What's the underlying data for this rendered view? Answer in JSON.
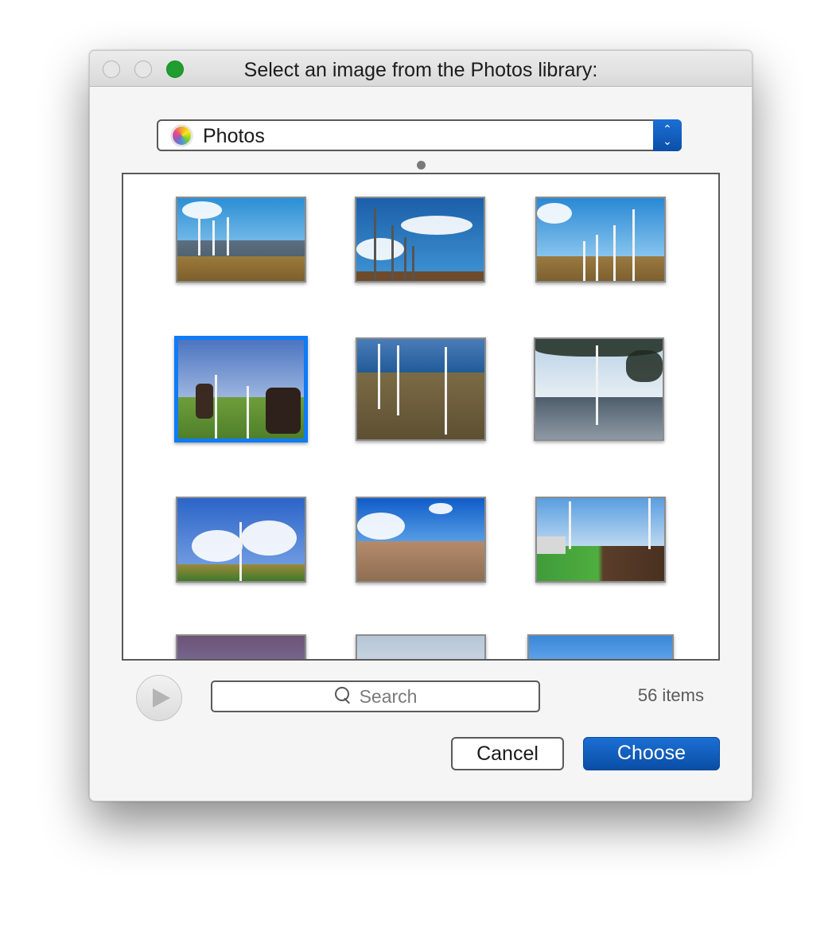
{
  "window": {
    "title": "Select an image from the Photos library:",
    "traffic_lights": [
      "close",
      "minimize",
      "zoom"
    ],
    "zoom_color": "#1f9d2e"
  },
  "source_popup": {
    "icon": "photos-app-icon",
    "selected": "Photos",
    "stepper_icon": "up-down-chevrons-icon"
  },
  "thumbnails": [
    {
      "subject": "wind farm with mountains and grassland",
      "selected": false
    },
    {
      "subject": "row of tall wind turbines under clouds",
      "selected": false
    },
    {
      "subject": "wind turbines on plain with fence",
      "selected": false
    },
    {
      "subject": "cows in field with wind turbines",
      "selected": true
    },
    {
      "subject": "coastal hill wind turbines",
      "selected": false
    },
    {
      "subject": "single turbine by shore under tree",
      "selected": false
    },
    {
      "subject": "single turbine with cumulus clouds",
      "selected": false
    },
    {
      "subject": "desert plain with clouds",
      "selected": false
    },
    {
      "subject": "turbines beside farmhouse and field",
      "selected": false
    },
    {
      "subject": "turbine at dusk (partially visible)",
      "selected": false
    },
    {
      "subject": "turbine in overcast sky (partially visible)",
      "selected": false
    },
    {
      "subject": "turbine in blue sky (partially visible)",
      "selected": false
    }
  ],
  "footer": {
    "play_icon": "play-slideshow-icon",
    "search_placeholder": "Search",
    "search_icon": "magnifier-icon",
    "item_count": "56 items"
  },
  "buttons": {
    "cancel": "Cancel",
    "choose": "Choose"
  },
  "accent_colors": {
    "selection": "#0f7bf6",
    "primary_button": "#0b58b8"
  }
}
